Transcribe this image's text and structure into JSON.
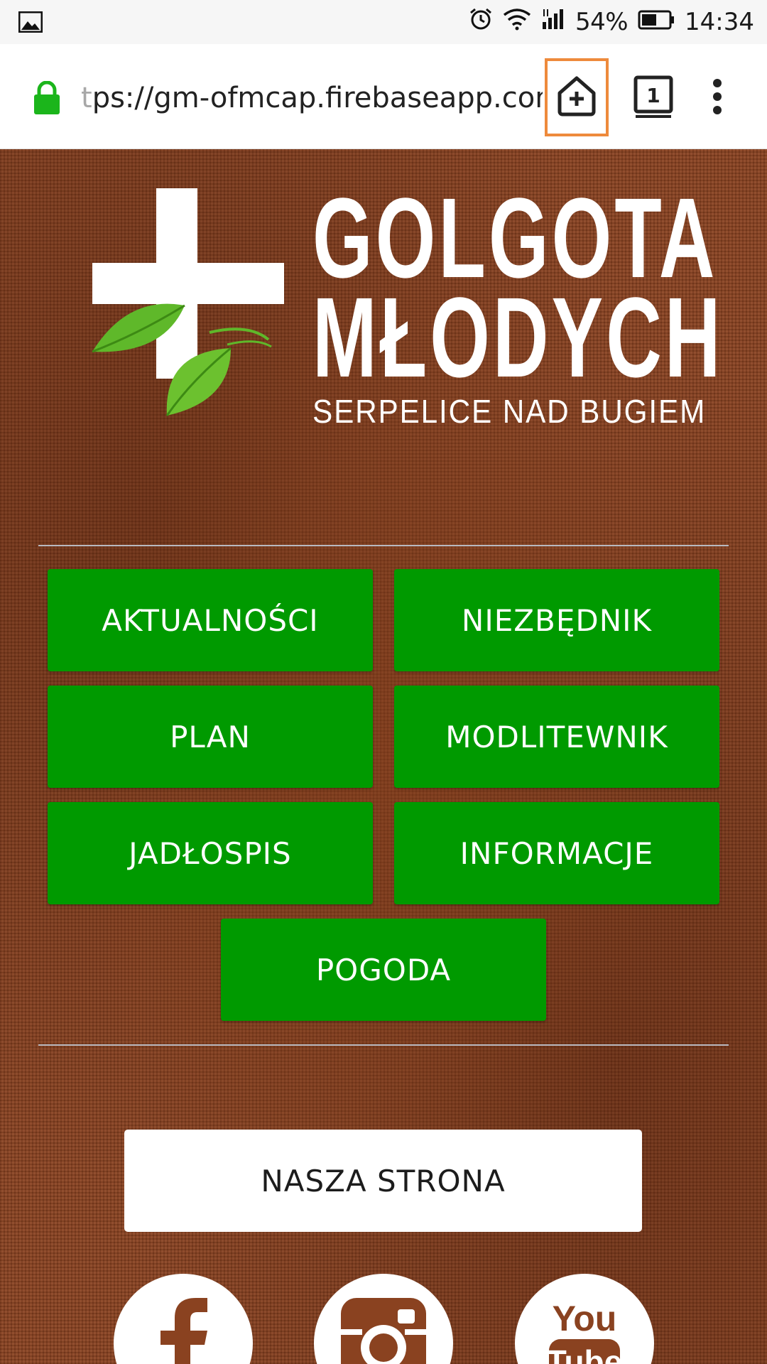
{
  "status_bar": {
    "battery": "54%",
    "time": "14:34",
    "icons": [
      "image-icon",
      "alarm-icon",
      "wifi-icon",
      "signal-icon",
      "battery-icon"
    ]
  },
  "browser": {
    "url_faded": "t",
    "url_main": "ps://gm-ofmcap.firebaseapp.com",
    "tab_count": "1",
    "colors": {
      "lock": "#1bb51b",
      "highlight": "#ee8a3c"
    }
  },
  "logo": {
    "title_line1": "GOLGOTA",
    "title_line2": "MŁODYCH",
    "subtitle": "SERPELICE NAD BUGIEM"
  },
  "nav": {
    "aktualnosci": "AKTUALNOŚCI",
    "niezbednik": "NIEZBĘDNIK",
    "plan": "PLAN",
    "modlitewnik": "MODLITEWNIK",
    "jadlospis": "JADŁOSPIS",
    "informacje": "INFORMACJE",
    "pogoda": "POGODA",
    "color": "#009a00"
  },
  "site_button": {
    "label": "NASZA STRONA"
  },
  "social": {
    "youtube_line1": "You",
    "youtube_line2": "Tube",
    "icons": [
      "facebook-icon",
      "instagram-icon",
      "youtube-icon"
    ]
  }
}
